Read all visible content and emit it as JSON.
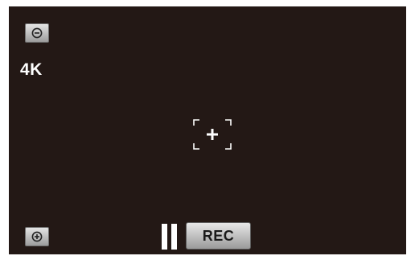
{
  "screen": {
    "background_color": "#231815",
    "resolution_label": "4K"
  },
  "controls": {
    "zoom_out_icon": "zoom-out-minus",
    "zoom_in_icon": "zoom-in-plus",
    "af_frame_icon": "focus-frame-plus",
    "pause_icon": "pause",
    "rec_label": "REC"
  }
}
